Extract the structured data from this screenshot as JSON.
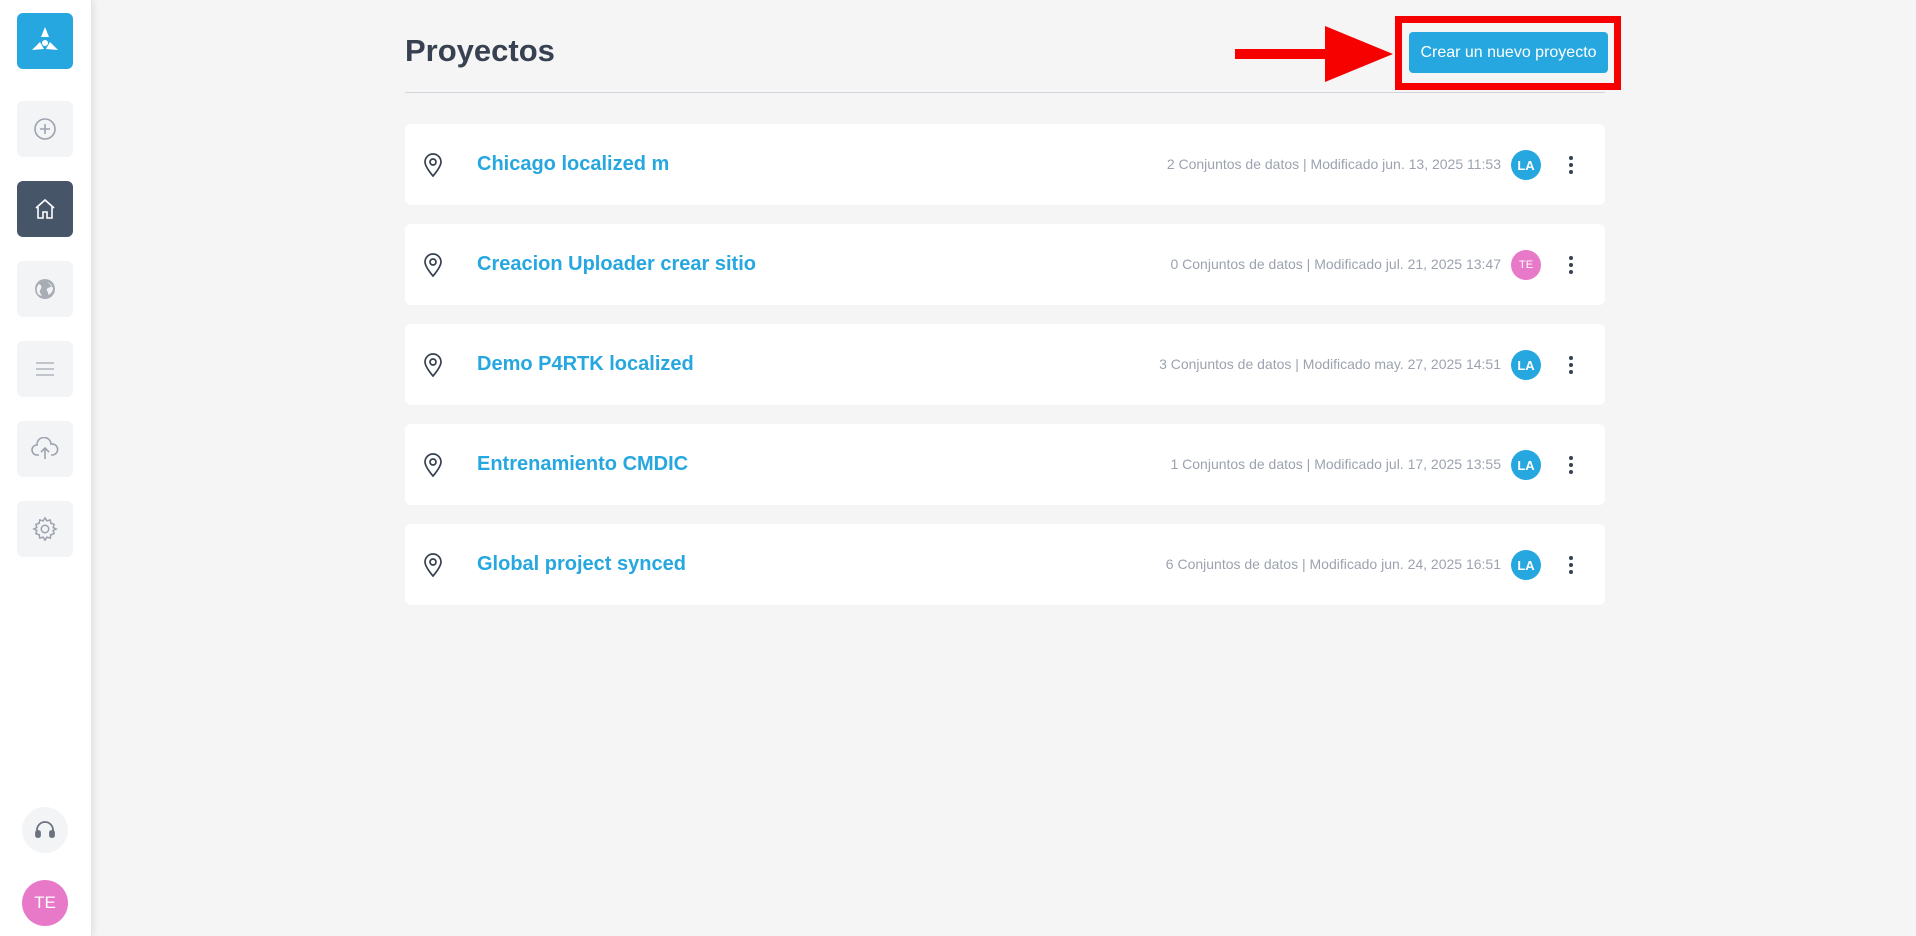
{
  "sidebar": {
    "logo_icon": "triangle-logo-icon",
    "items": [
      {
        "name": "add",
        "icon": "plus-circle-icon",
        "active": false
      },
      {
        "name": "home",
        "icon": "home-icon",
        "active": true
      },
      {
        "name": "globe",
        "icon": "globe-icon",
        "active": false
      },
      {
        "name": "list",
        "icon": "menu-lines-icon",
        "active": false
      },
      {
        "name": "upload",
        "icon": "cloud-upload-icon",
        "active": false
      },
      {
        "name": "settings",
        "icon": "gear-icon",
        "active": false
      }
    ],
    "support_icon": "headset-icon",
    "user_initials": "TE"
  },
  "header": {
    "title": "Proyectos",
    "create_button_label": "Crear un nuevo proyecto"
  },
  "colors": {
    "accent": "#26a7df",
    "sidebar_active": "#475569",
    "annotation_red": "#f70000",
    "avatar_pink": "#e879c8"
  },
  "projects": [
    {
      "name": "Chicago localized m",
      "meta": "2 Conjuntos de datos | Modificado jun. 13, 2025 11:53",
      "owner": "LA",
      "owner_color": "#26a7df"
    },
    {
      "name": "Creacion Uploader crear sitio",
      "meta": "0 Conjuntos de datos | Modificado jul. 21, 2025 13:47",
      "owner": "TE",
      "owner_color": "#e879c8"
    },
    {
      "name": "Demo P4RTK localized",
      "meta": "3 Conjuntos de datos | Modificado may. 27, 2025 14:51",
      "owner": "LA",
      "owner_color": "#26a7df"
    },
    {
      "name": "Entrenamiento CMDIC",
      "meta": "1 Conjuntos de datos | Modificado jul. 17, 2025 13:55",
      "owner": "LA",
      "owner_color": "#26a7df"
    },
    {
      "name": "Global project synced",
      "meta": "6 Conjuntos de datos | Modificado jun. 24, 2025 16:51",
      "owner": "LA",
      "owner_color": "#26a7df"
    }
  ]
}
